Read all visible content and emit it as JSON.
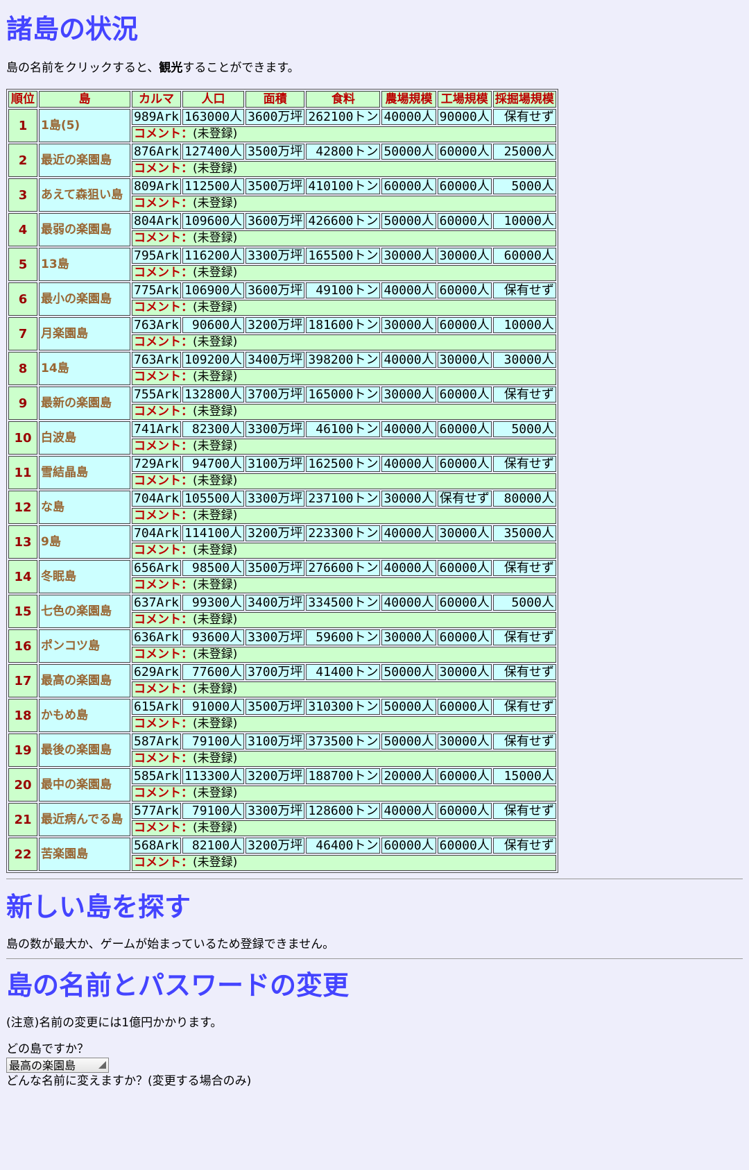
{
  "rankings": {
    "title": "諸島の状況",
    "intro_before": "島の名前をクリックすると、",
    "intro_bold": "観光",
    "intro_after": "することができます。",
    "headers": [
      "順位",
      "島",
      "カルマ",
      "人口",
      "面積",
      "食料",
      "農場規模",
      "工場規模",
      "採掘場規模"
    ],
    "comment_label": "コメント：",
    "rows": [
      {
        "rank": "1",
        "name": "1島(5)",
        "karma": "989Ark",
        "pop": "163000人",
        "area": "3600万坪",
        "food": "262100トン",
        "farm": "40000人",
        "factory": "90000人",
        "mine": "保有せず",
        "comment": "(未登録)"
      },
      {
        "rank": "2",
        "name": "最近の楽園島",
        "karma": "876Ark",
        "pop": "127400人",
        "area": "3500万坪",
        "food": "42800トン",
        "farm": "50000人",
        "factory": "60000人",
        "mine": "25000人",
        "comment": "(未登録)"
      },
      {
        "rank": "3",
        "name": "あえて森狙い島",
        "karma": "809Ark",
        "pop": "112500人",
        "area": "3500万坪",
        "food": "410100トン",
        "farm": "60000人",
        "factory": "60000人",
        "mine": "5000人",
        "comment": "(未登録)"
      },
      {
        "rank": "4",
        "name": "最弱の楽園島",
        "karma": "804Ark",
        "pop": "109600人",
        "area": "3600万坪",
        "food": "426600トン",
        "farm": "50000人",
        "factory": "60000人",
        "mine": "10000人",
        "comment": "(未登録)"
      },
      {
        "rank": "5",
        "name": "13島",
        "karma": "795Ark",
        "pop": "116200人",
        "area": "3300万坪",
        "food": "165500トン",
        "farm": "30000人",
        "factory": "30000人",
        "mine": "60000人",
        "comment": "(未登録)"
      },
      {
        "rank": "6",
        "name": "最小の楽園島",
        "karma": "775Ark",
        "pop": "106900人",
        "area": "3600万坪",
        "food": "49100トン",
        "farm": "40000人",
        "factory": "60000人",
        "mine": "保有せず",
        "comment": "(未登録)"
      },
      {
        "rank": "7",
        "name": "月楽園島",
        "karma": "763Ark",
        "pop": "90600人",
        "area": "3200万坪",
        "food": "181600トン",
        "farm": "30000人",
        "factory": "60000人",
        "mine": "10000人",
        "comment": "(未登録)"
      },
      {
        "rank": "8",
        "name": "14島",
        "karma": "763Ark",
        "pop": "109200人",
        "area": "3400万坪",
        "food": "398200トン",
        "farm": "40000人",
        "factory": "30000人",
        "mine": "30000人",
        "comment": "(未登録)"
      },
      {
        "rank": "9",
        "name": "最新の楽園島",
        "karma": "755Ark",
        "pop": "132800人",
        "area": "3700万坪",
        "food": "165000トン",
        "farm": "30000人",
        "factory": "60000人",
        "mine": "保有せず",
        "comment": "(未登録)"
      },
      {
        "rank": "10",
        "name": "白波島",
        "karma": "741Ark",
        "pop": "82300人",
        "area": "3300万坪",
        "food": "46100トン",
        "farm": "40000人",
        "factory": "60000人",
        "mine": "5000人",
        "comment": "(未登録)"
      },
      {
        "rank": "11",
        "name": "雪結晶島",
        "karma": "729Ark",
        "pop": "94700人",
        "area": "3100万坪",
        "food": "162500トン",
        "farm": "40000人",
        "factory": "60000人",
        "mine": "保有せず",
        "comment": "(未登録)"
      },
      {
        "rank": "12",
        "name": "な島",
        "karma": "704Ark",
        "pop": "105500人",
        "area": "3300万坪",
        "food": "237100トン",
        "farm": "30000人",
        "factory": "保有せず",
        "mine": "80000人",
        "comment": "(未登録)"
      },
      {
        "rank": "13",
        "name": "9島",
        "karma": "704Ark",
        "pop": "114100人",
        "area": "3200万坪",
        "food": "223300トン",
        "farm": "40000人",
        "factory": "30000人",
        "mine": "35000人",
        "comment": "(未登録)"
      },
      {
        "rank": "14",
        "name": "冬眠島",
        "karma": "656Ark",
        "pop": "98500人",
        "area": "3500万坪",
        "food": "276600トン",
        "farm": "40000人",
        "factory": "60000人",
        "mine": "保有せず",
        "comment": "(未登録)"
      },
      {
        "rank": "15",
        "name": "七色の楽園島",
        "karma": "637Ark",
        "pop": "99300人",
        "area": "3400万坪",
        "food": "334500トン",
        "farm": "40000人",
        "factory": "60000人",
        "mine": "5000人",
        "comment": "(未登録)"
      },
      {
        "rank": "16",
        "name": "ポンコツ島",
        "karma": "636Ark",
        "pop": "93600人",
        "area": "3300万坪",
        "food": "59600トン",
        "farm": "30000人",
        "factory": "60000人",
        "mine": "保有せず",
        "comment": "(未登録)"
      },
      {
        "rank": "17",
        "name": "最高の楽園島",
        "karma": "629Ark",
        "pop": "77600人",
        "area": "3700万坪",
        "food": "41400トン",
        "farm": "50000人",
        "factory": "30000人",
        "mine": "保有せず",
        "comment": "(未登録)"
      },
      {
        "rank": "18",
        "name": "かもめ島",
        "karma": "615Ark",
        "pop": "91000人",
        "area": "3500万坪",
        "food": "310300トン",
        "farm": "50000人",
        "factory": "60000人",
        "mine": "保有せず",
        "comment": "(未登録)"
      },
      {
        "rank": "19",
        "name": "最後の楽園島",
        "karma": "587Ark",
        "pop": "79100人",
        "area": "3100万坪",
        "food": "373500トン",
        "farm": "50000人",
        "factory": "30000人",
        "mine": "保有せず",
        "comment": "(未登録)"
      },
      {
        "rank": "20",
        "name": "最中の楽園島",
        "karma": "585Ark",
        "pop": "113300人",
        "area": "3200万坪",
        "food": "188700トン",
        "farm": "20000人",
        "factory": "60000人",
        "mine": "15000人",
        "comment": "(未登録)"
      },
      {
        "rank": "21",
        "name": "最近病んでる島",
        "karma": "577Ark",
        "pop": "79100人",
        "area": "3300万坪",
        "food": "128600トン",
        "farm": "40000人",
        "factory": "60000人",
        "mine": "保有せず",
        "comment": "(未登録)"
      },
      {
        "rank": "22",
        "name": "苦楽園島",
        "karma": "568Ark",
        "pop": "82100人",
        "area": "3200万坪",
        "food": "46400トン",
        "farm": "60000人",
        "factory": "60000人",
        "mine": "保有せず",
        "comment": "(未登録)"
      }
    ]
  },
  "new_island": {
    "title": "新しい島を探す",
    "message": "島の数が最大か、ゲームが始まっているため登録できません。"
  },
  "rename": {
    "title": "島の名前とパスワードの変更",
    "note": "(注意)名前の変更には1億円かかります。",
    "which_label": "どの島ですか？",
    "selected_island": "最高の楽園島",
    "newname_label": "どんな名前に変えますか？(変更する場合のみ)"
  },
  "colors": {
    "background": "#eeeefb",
    "heading": "#4444ff",
    "header_text": "#bb0000",
    "name_text": "#996633",
    "green_cell": "#ccffcc",
    "cyan_cell": "#ccffff"
  }
}
